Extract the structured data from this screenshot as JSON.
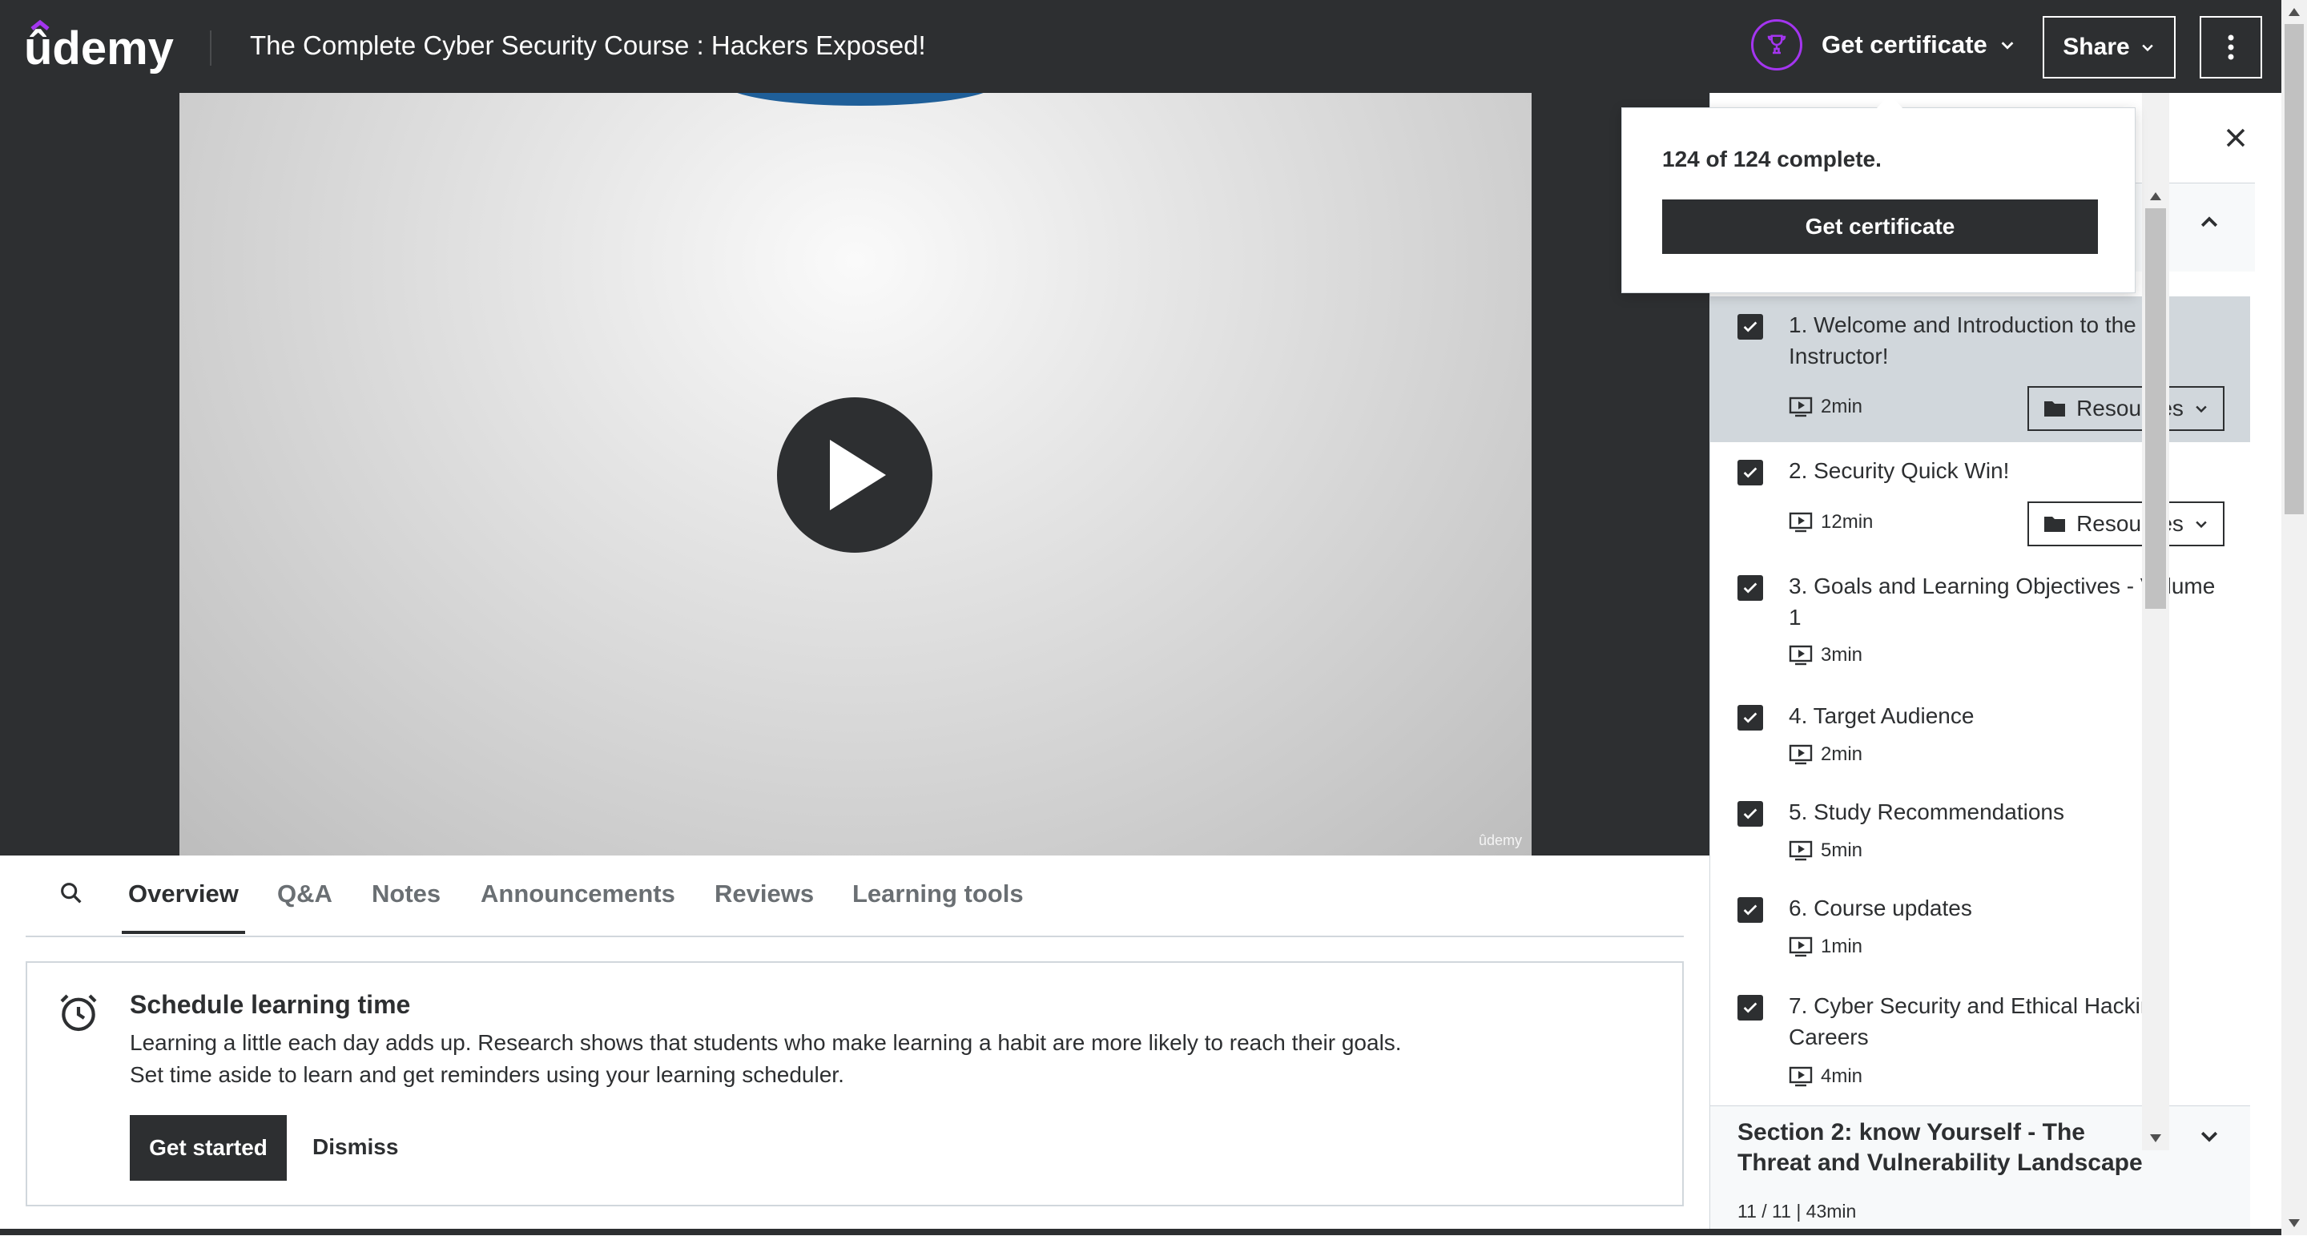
{
  "header": {
    "logo_text": "ûdemy",
    "course_title": "The Complete Cyber Security Course : Hackers Exposed!",
    "get_certificate_label": "Get certificate",
    "share_label": "Share"
  },
  "video": {
    "watermark": "ûdemy"
  },
  "certificate_popover": {
    "progress_text": "124 of 124 complete.",
    "button_label": "Get certificate"
  },
  "tabs": {
    "items": [
      {
        "label": "Overview"
      },
      {
        "label": "Q&A"
      },
      {
        "label": "Notes"
      },
      {
        "label": "Announcements"
      },
      {
        "label": "Reviews"
      },
      {
        "label": "Learning tools"
      }
    ],
    "active": "Overview"
  },
  "schedule": {
    "title": "Schedule learning time",
    "line1": "Learning a little each day adds up. Research shows that students who make learning a habit are more likely to reach their goals.",
    "line2": "Set time aside to learn and get reminders using your learning scheduler.",
    "start_label": "Get started",
    "dismiss_label": "Dismiss"
  },
  "curriculum": {
    "lectures": [
      {
        "title": "1. Welcome and Introduction to the Instructor!",
        "duration": "2min",
        "resources": "Resources",
        "completed": true,
        "active": true
      },
      {
        "title": "2. Security Quick Win!",
        "duration": "12min",
        "resources": "Resources",
        "completed": true
      },
      {
        "title": "3. Goals and Learning Objectives - Volume 1",
        "duration": "3min",
        "completed": true
      },
      {
        "title": "4. Target Audience",
        "duration": "2min",
        "completed": true
      },
      {
        "title": "5. Study Recommendations",
        "duration": "5min",
        "completed": true
      },
      {
        "title": "6. Course updates",
        "duration": "1min",
        "completed": true
      },
      {
        "title": "7. Cyber Security and Ethical Hacking Careers",
        "duration": "4min",
        "completed": true
      }
    ],
    "section2": {
      "title": "Section 2: know Yourself - The Threat and Vulnerability Landscape",
      "meta": "11 / 11 | 43min"
    }
  },
  "colors": {
    "dark": "#2d2f31",
    "accent_purple": "#a435f0",
    "active_row": "#d1d7dc"
  }
}
